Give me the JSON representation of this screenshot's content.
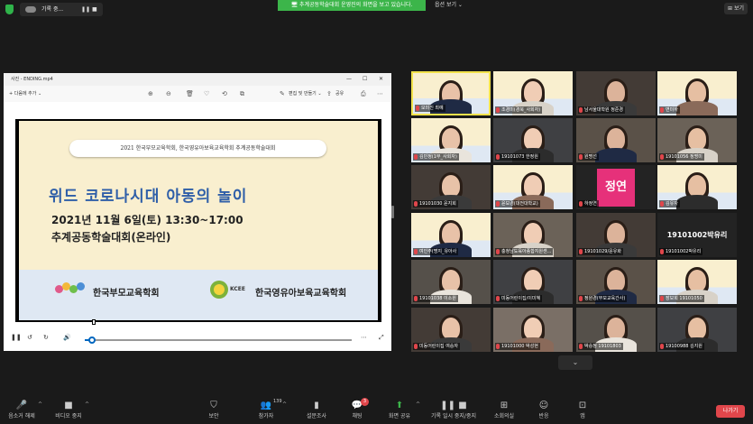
{
  "topbar": {
    "rec_label": "기록 중...",
    "pause": "❚❚",
    "stop": "■",
    "notice": "추계공동학술대회 운영진의 화면을 보고 있습니다.",
    "view_options": "옵션 보기 ⌄",
    "view": "보기"
  },
  "window": {
    "title": "사진 - ENDING.mp4",
    "controls": [
      "—",
      "☐",
      "✕"
    ],
    "add_label": "+ 다음에 추가 ⌄",
    "edit_label": "편집 및 만들기 ⌄",
    "share_label": "공유"
  },
  "slide": {
    "banner": "2021 한국부모교육학회, 한국영유아보육교육학회 추계공동학술대회",
    "title": "위드 코로나시대 아동의 놀이",
    "date": "2021년 11월 6일(토) 13:30~17:00",
    "subtitle": "추계공동학술대회(온라인)",
    "org1": "한국부모교육학회",
    "org2_abbr": "KCEE",
    "org2": "한국영유아보육교육학회"
  },
  "player": {
    "progress": 0.02
  },
  "colors": {
    "notice_green": "#3cb54a",
    "active_border": "#f2e24b",
    "leave_red": "#e0464b",
    "name_pink": "#e6317a"
  },
  "gallery": {
    "tiles": [
      {
        "name": "모미진 최예",
        "kind": "slide",
        "active": true
      },
      {
        "name": "조경미(경북_사회자)",
        "kind": "slide"
      },
      {
        "name": "남서울대학원 정준경",
        "kind": "person"
      },
      {
        "name": "변미하",
        "kind": "slide"
      },
      {
        "name": "김민정(1부_사회자)",
        "kind": "slide"
      },
      {
        "name": "19101073 한정원",
        "kind": "person"
      },
      {
        "name": "원명선",
        "kind": "person"
      },
      {
        "name": "19101056 정명미",
        "kind": "person"
      },
      {
        "name": "19101030 윤지희",
        "kind": "person"
      },
      {
        "name": "윤보경(대전대학교)",
        "kind": "slide"
      },
      {
        "name": "하정연",
        "kind": "pink",
        "big": "정연"
      },
      {
        "name": "김유자",
        "kind": "slide"
      },
      {
        "name": "여인주(명지_유아사",
        "kind": "slide"
      },
      {
        "name": "충청남도육아종합지원센...",
        "kind": "person"
      },
      {
        "name": "19101029/윤유화",
        "kind": "person"
      },
      {
        "name": "19101002박유리",
        "kind": "text",
        "big": "19101002박유리"
      },
      {
        "name": "19101038 이소원",
        "kind": "person"
      },
      {
        "name": "미동어린이집/이미혜",
        "kind": "person"
      },
      {
        "name": "정원경(부모교육간사)",
        "kind": "person"
      },
      {
        "name": "장보희 19101050",
        "kind": "slide"
      },
      {
        "name": "미동어린이집 여승자",
        "kind": "person"
      },
      {
        "name": "19101000 박성현",
        "kind": "person"
      },
      {
        "name": "박승정 19101803",
        "kind": "person"
      },
      {
        "name": "19100988 김지원",
        "kind": "person"
      }
    ],
    "scroll_down": "⌄"
  },
  "bottombar": {
    "items": [
      {
        "key": "mute",
        "icon": "🎤",
        "label": "음소거 해제"
      },
      {
        "key": "video",
        "icon": "■",
        "label": "비디오 중지"
      },
      {
        "key": "security",
        "icon": "⛉",
        "label": "보안"
      },
      {
        "key": "participants",
        "icon": "👥",
        "label": "참가자",
        "count": "139"
      },
      {
        "key": "poll",
        "icon": "▮",
        "label": "설문조사"
      },
      {
        "key": "chat",
        "icon": "💬",
        "label": "채팅",
        "badge": "3"
      },
      {
        "key": "share",
        "icon": "⬆",
        "label": "화면 공유"
      },
      {
        "key": "record",
        "icon": "❚❚ ■",
        "label": "기록 일시 중지/중지"
      },
      {
        "key": "rooms",
        "icon": "⊞",
        "label": "소회의실"
      },
      {
        "key": "reactions",
        "icon": "☺",
        "label": "반응"
      },
      {
        "key": "apps",
        "icon": "⊡",
        "label": "앱"
      }
    ],
    "leave": "나가기"
  }
}
